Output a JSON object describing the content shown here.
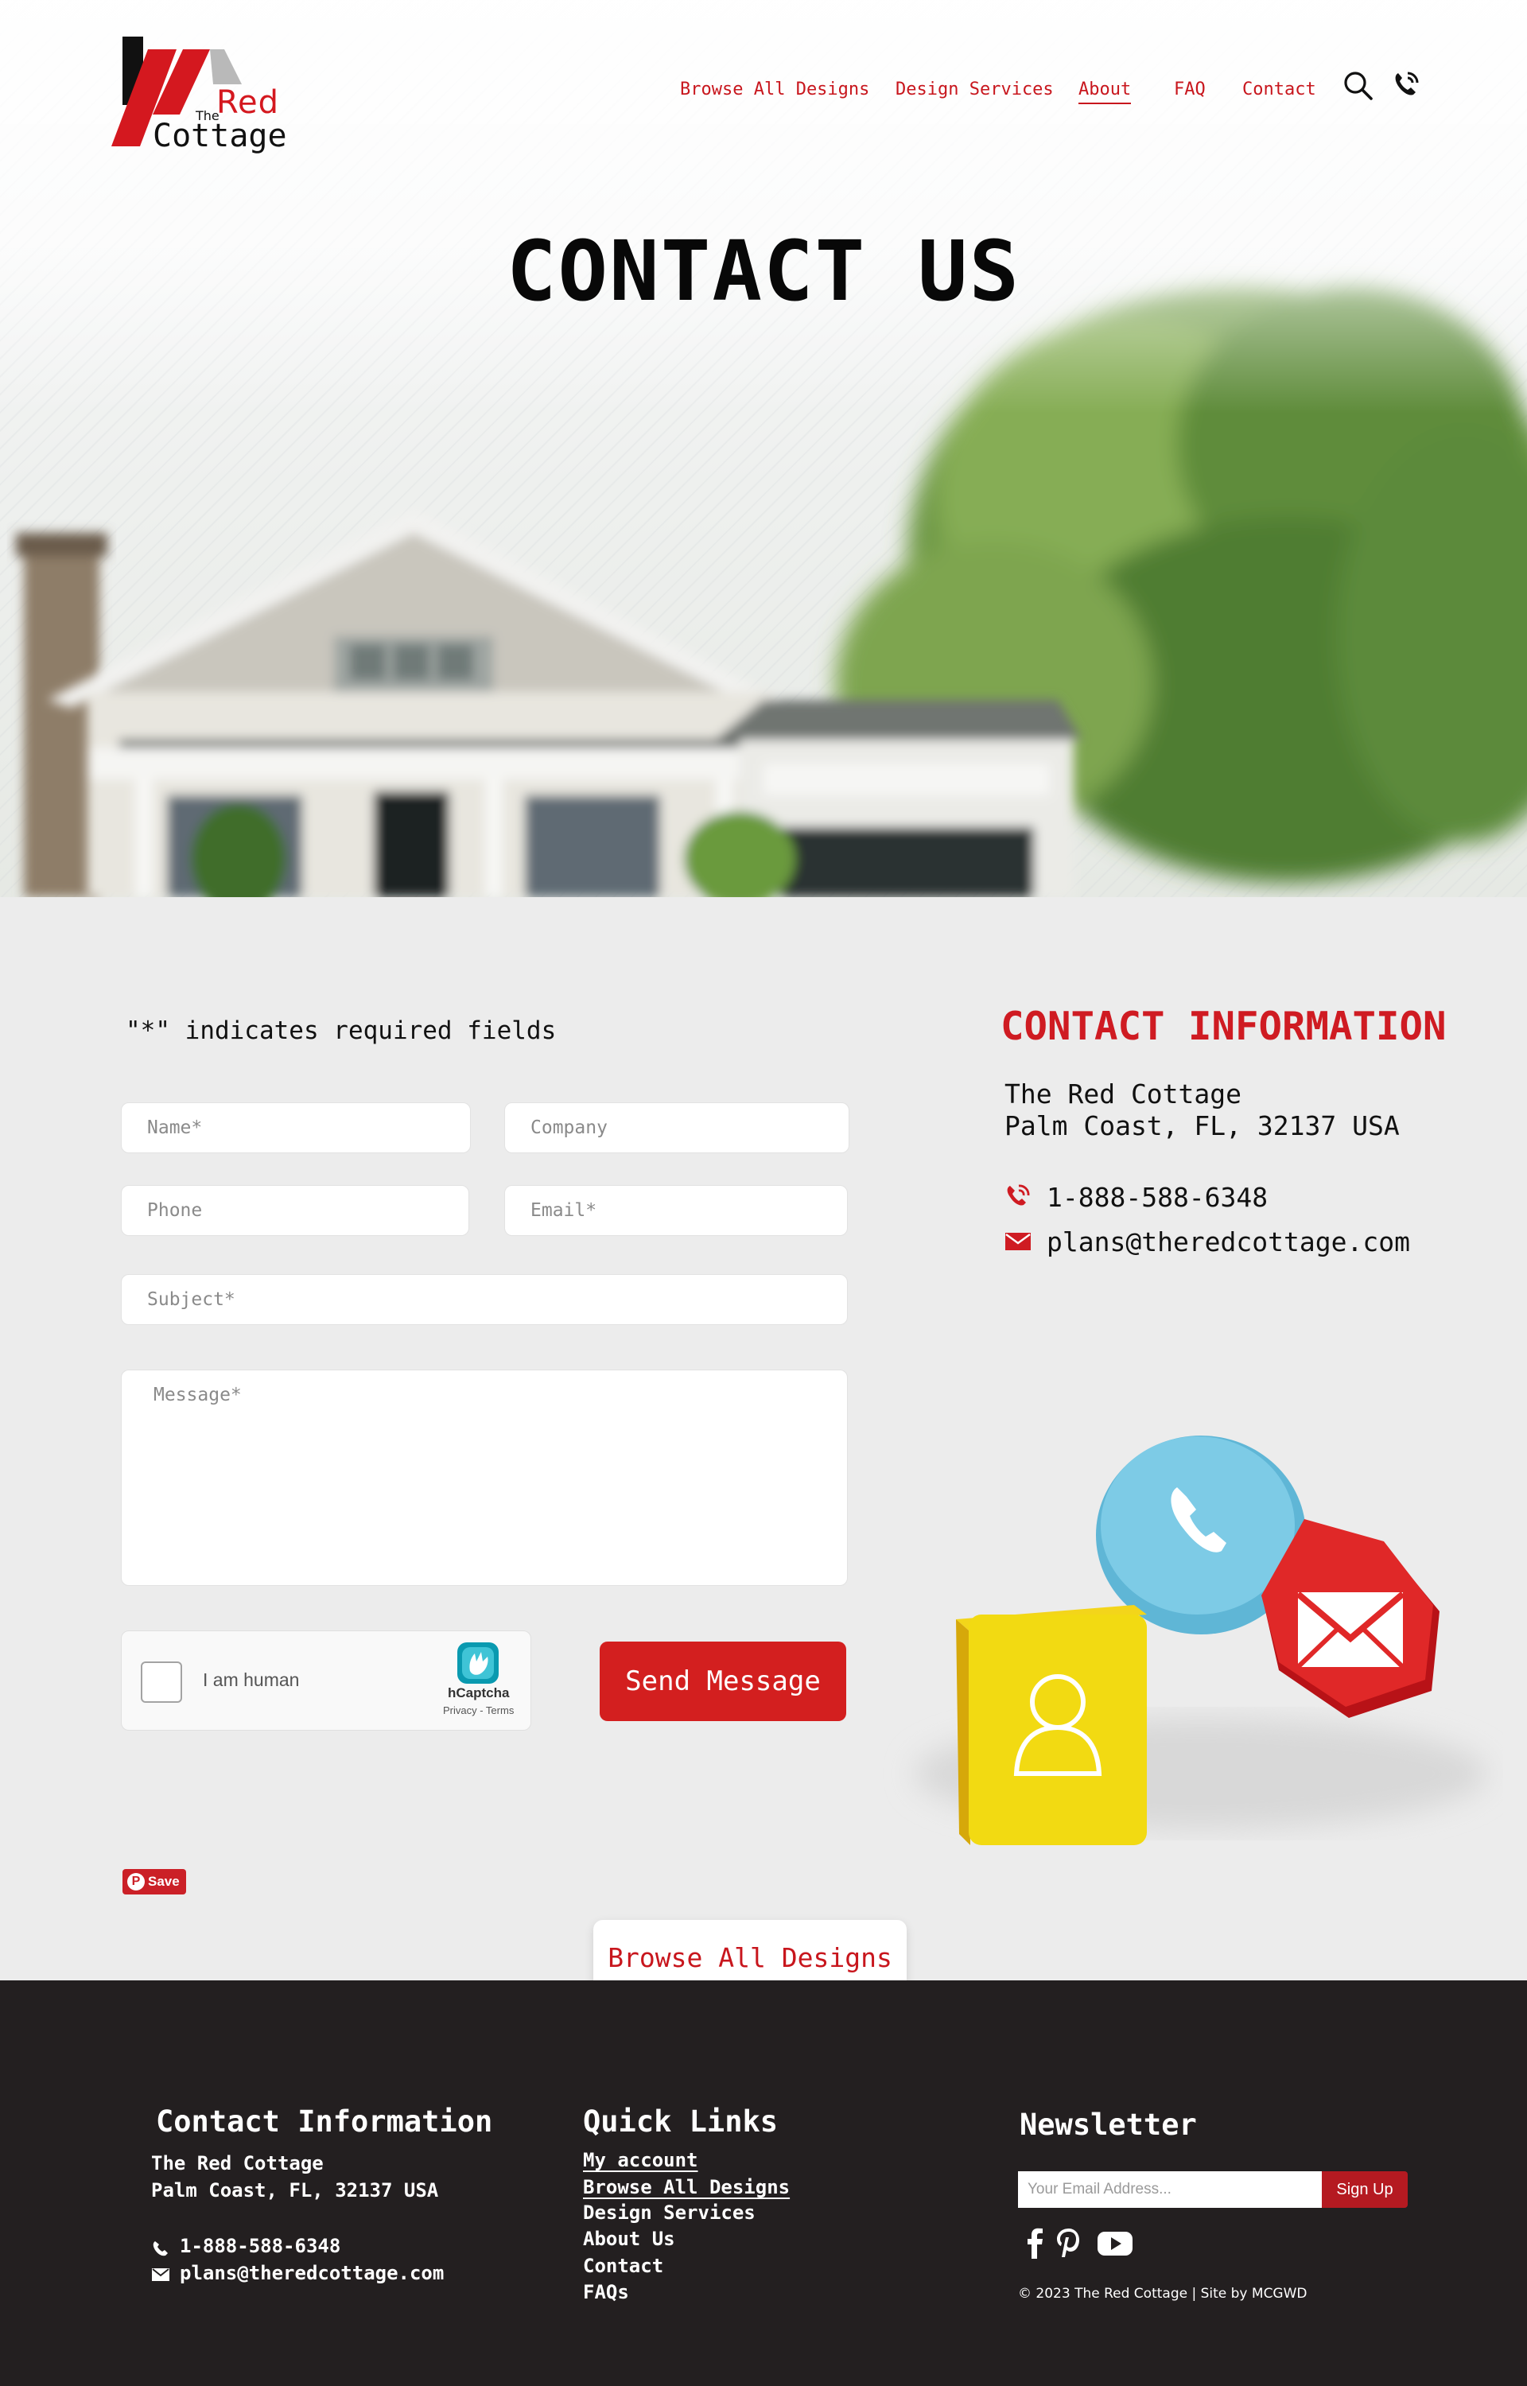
{
  "brand": {
    "logo_the": "The",
    "logo_red": "Red",
    "logo_cottage": "Cottage",
    "red_color": "#d4181f"
  },
  "nav": {
    "items": [
      {
        "label": "Browse All Designs"
      },
      {
        "label": "Design Services"
      },
      {
        "label": "About"
      },
      {
        "label": "FAQ"
      },
      {
        "label": "Contact"
      }
    ],
    "search_icon": "search-icon",
    "phone_icon": "phone-icon"
  },
  "hero": {
    "title": "CONTACT US"
  },
  "form": {
    "required_note": "\"*\" indicates required fields",
    "name_placeholder": "Name*",
    "company_placeholder": "Company",
    "phone_placeholder": "Phone",
    "email_placeholder": "Email*",
    "subject_placeholder": "Subject*",
    "message_placeholder": "Message*",
    "captcha_label": "I am human",
    "captcha_brand": "hCaptcha",
    "captcha_links": "Privacy - Terms",
    "submit_label": "Send Message",
    "accent_color": "#d31f1f"
  },
  "contact_info": {
    "title": "CONTACT INFORMATION",
    "company": "The Red Cottage",
    "address": "Palm Coast, FL, 32137 USA",
    "phone": "1-888-588-6348",
    "email": "plans@theredcottage.com"
  },
  "pinterest": {
    "save_label": "Save"
  },
  "browse_button": {
    "label": "Browse All Designs"
  },
  "footer": {
    "contact": {
      "heading": "Contact Information",
      "company": "The Red Cottage",
      "address": "Palm Coast, FL, 32137 USA",
      "phone": "1-888-588-6348",
      "email": "plans@theredcottage.com"
    },
    "quick_links": {
      "heading": "Quick Links",
      "items": [
        {
          "label": "My account"
        },
        {
          "label": "Browse All Designs"
        },
        {
          "label": "Design Services"
        },
        {
          "label": "About Us"
        },
        {
          "label": "Contact"
        },
        {
          "label": "FAQs"
        }
      ]
    },
    "newsletter": {
      "heading": "Newsletter",
      "placeholder": "Your Email Address...",
      "button": "Sign Up",
      "button_color": "#b51a21",
      "social": [
        "facebook-icon",
        "pinterest-icon",
        "youtube-icon"
      ]
    },
    "copyright": "© 2023 The Red Cottage  |  Site by MCGWD",
    "background_color": "#231f20"
  }
}
